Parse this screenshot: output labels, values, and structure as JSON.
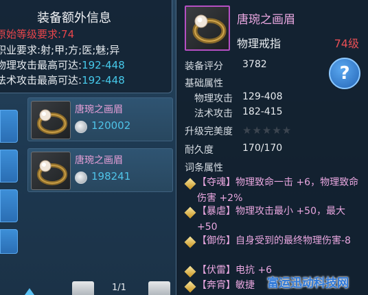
{
  "extra_info": {
    "title": "装备额外信息",
    "level_req": "原始等级要求:74",
    "class_req": "职业要求:射;甲;方;医;魅;异",
    "phys_label": "物理攻击最高可达:",
    "phys_value": "192-448",
    "magic_label": "法术攻击最高可达:",
    "magic_value": "192-448"
  },
  "items": [
    {
      "name": "唐琬之画眉",
      "price": "120002",
      "icon": "ring-icon"
    },
    {
      "name": "唐琬之画眉",
      "price": "198241",
      "icon": "ring-icon"
    }
  ],
  "pagination": {
    "page": "1/1"
  },
  "tooltip": {
    "name": "唐琬之画眉",
    "type": "物理戒指",
    "level": "74级",
    "score_label": "装备评分",
    "score": "3782",
    "base_label": "基础属性",
    "phys_attack_label": "物理攻击",
    "phys_attack": "129-408",
    "magic_attack_label": "法术攻击",
    "magic_attack": "182-415",
    "upgrade_label": "升级完美度",
    "upgrade_stars": 0,
    "durability_label": "耐久度",
    "durability": "170/170",
    "affix_label": "词条属性",
    "affixes": [
      {
        "tag": "【夺魂】",
        "text": "物理致命一击 +6，物理致命伤害 +2%"
      },
      {
        "tag": "【暴虐】",
        "text": "物理攻击最小 +50，最大 +50"
      },
      {
        "tag": "【御伤】",
        "text": "自身受到的最终物理伤害-8"
      },
      {
        "tag": "【伏雷】",
        "text": "电抗 +6"
      },
      {
        "tag": "【奔宵】",
        "text": "敏捷"
      }
    ],
    "help_icon": "question-icon"
  },
  "watermark": "富运迅动科技网",
  "colors": {
    "accent_pink": "#e9a7e0",
    "accent_red": "#e84f55",
    "accent_cyan": "#46c9ea"
  }
}
